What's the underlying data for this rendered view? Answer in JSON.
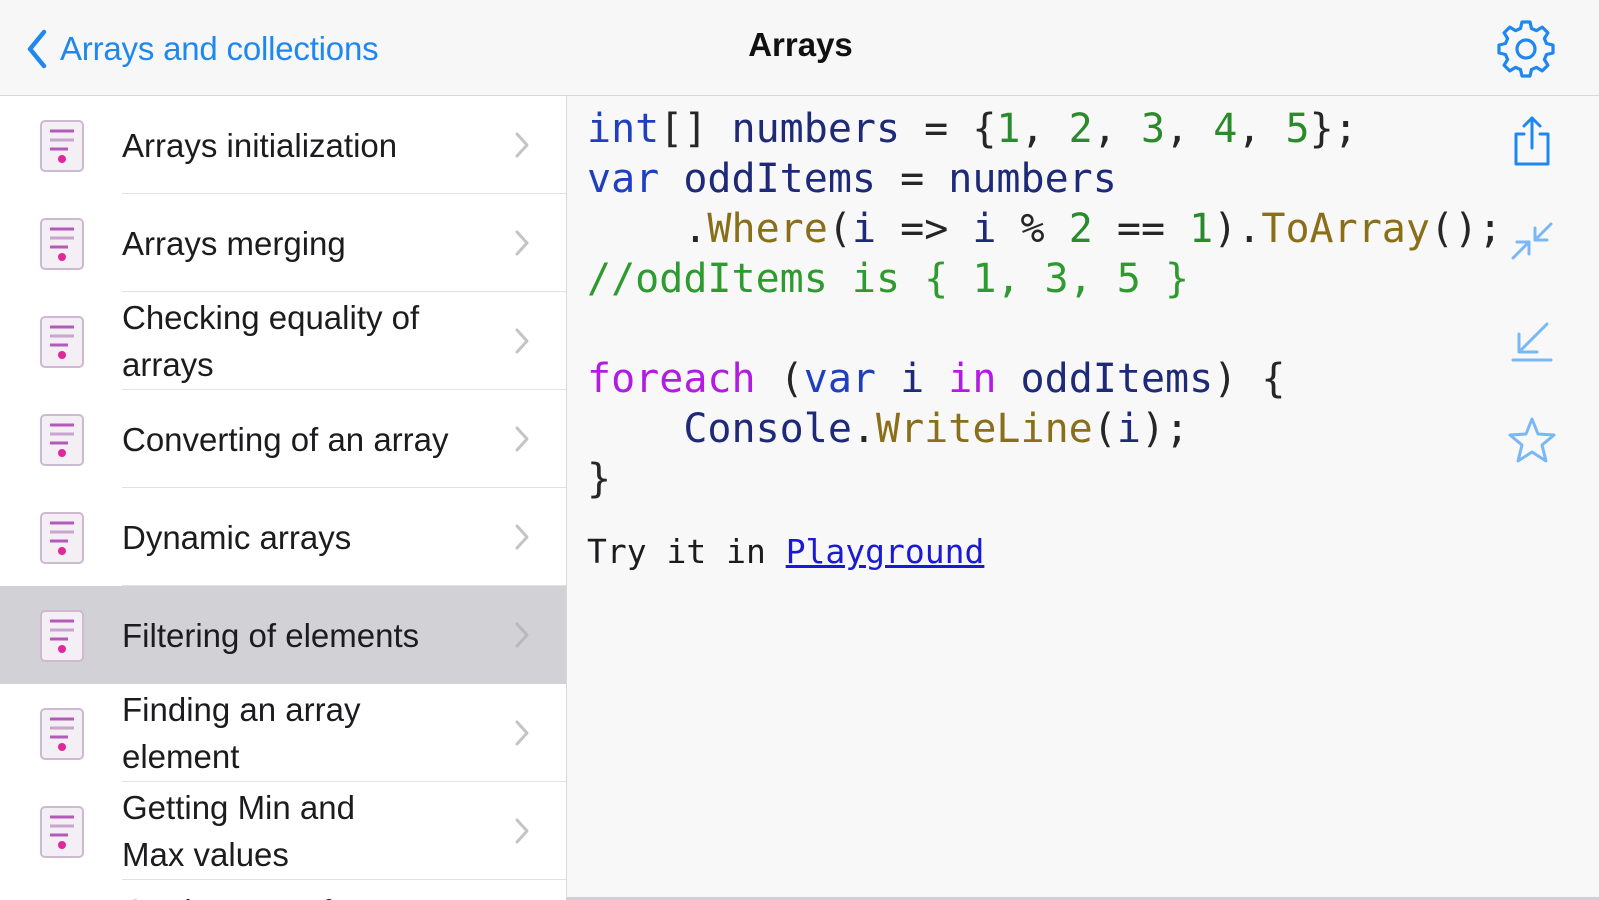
{
  "navbar": {
    "back_label": "Arrays and collections",
    "title": "Arrays",
    "back_icon": "chevron-left-icon",
    "settings_icon": "gear-icon"
  },
  "colors": {
    "accent": "#1e88f0",
    "selected_row": "#d1d1d6",
    "keyword": "#1f3fbf",
    "control_keyword": "#b21ce0",
    "number": "#2b8a2b",
    "method": "#8a6f1a",
    "comment": "#2f9a2f"
  },
  "sidebar": {
    "items": [
      {
        "label": "Arrays initialization",
        "selected": false
      },
      {
        "label": "Arrays merging",
        "selected": false
      },
      {
        "label": "Checking equality of arrays",
        "selected": false
      },
      {
        "label": "Converting of an array",
        "selected": false
      },
      {
        "label": "Dynamic arrays",
        "selected": false
      },
      {
        "label": "Filtering of elements",
        "selected": true
      },
      {
        "label": "Finding an array element",
        "selected": false
      },
      {
        "label": "Getting Min and Max values",
        "selected": false
      },
      {
        "label": "Getting part of",
        "selected": false
      }
    ]
  },
  "content": {
    "code": {
      "int": "int",
      "brackets": "[] ",
      "numbers": "numbers",
      "eq": " = {",
      "n1": "1",
      "n2": "2",
      "n3": "3",
      "n4": "4",
      "n5": "5",
      "comma": ", ",
      "close": "};",
      "var": "var",
      "oddItems": "oddItems",
      "where": "Where",
      "lambda_i": "i",
      "arrow": " => ",
      "mod": " % ",
      "eqeq": " == ",
      "toArray": "ToArray",
      "comment": "//oddItems is { 1, 3, 5 }",
      "foreach": "foreach",
      "in": "in",
      "console": "Console",
      "writeLine": "WriteLine"
    },
    "try_prefix": "Try it in ",
    "playground_link": "Playground"
  },
  "tools": {
    "share_icon": "share-icon",
    "collapse_icon": "collapse-arrows-icon",
    "download_icon": "arrow-down-left-icon",
    "favorite_icon": "star-icon"
  }
}
